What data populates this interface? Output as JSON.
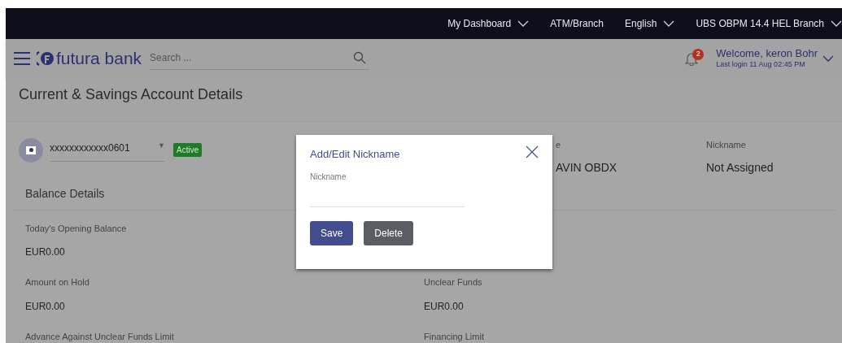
{
  "top_bar": {
    "items": [
      {
        "label": "My Dashboard",
        "has_caret": true
      },
      {
        "label": "ATM/Branch",
        "has_caret": false
      },
      {
        "label": "English",
        "has_caret": true
      },
      {
        "label": "UBS OBPM 14.4 HEL Branch",
        "has_caret": true
      }
    ]
  },
  "header": {
    "logo": "futura bank",
    "search": {
      "placeholder": "Search ..."
    },
    "notifications": "2",
    "welcome": "Welcome, keron Bohr",
    "last_login": "Last login 11 Aug 02:45 PM"
  },
  "page": {
    "title": "Current & Savings Account Details",
    "account": {
      "number": "xxxxxxxxxxxx0601",
      "caret": "▼",
      "status": "Active"
    },
    "fields": [
      {
        "label": "e",
        "value": "AVIN OBDX"
      },
      {
        "label": "Nickname",
        "value": "Not Assigned"
      }
    ],
    "section": "Balance Details",
    "rows": [
      [
        {
          "label": "Today's Opening Balance",
          "value": "EUR0.00"
        }
      ],
      [
        {
          "label": "Amount on Hold",
          "value": "EUR0.00"
        },
        {
          "label": "Unclear Funds",
          "value": "EUR0.00"
        }
      ],
      [
        {
          "label": "Advance Against Unclear Funds Limit"
        },
        {
          "label": "Financing Limit"
        }
      ]
    ]
  },
  "dialog": {
    "title": "Add/Edit Nickname",
    "field_label": "Nickname",
    "buttons": [
      {
        "label": "Save",
        "kind": "primary"
      },
      {
        "label": "Delete",
        "kind": "secondary"
      }
    ]
  }
}
